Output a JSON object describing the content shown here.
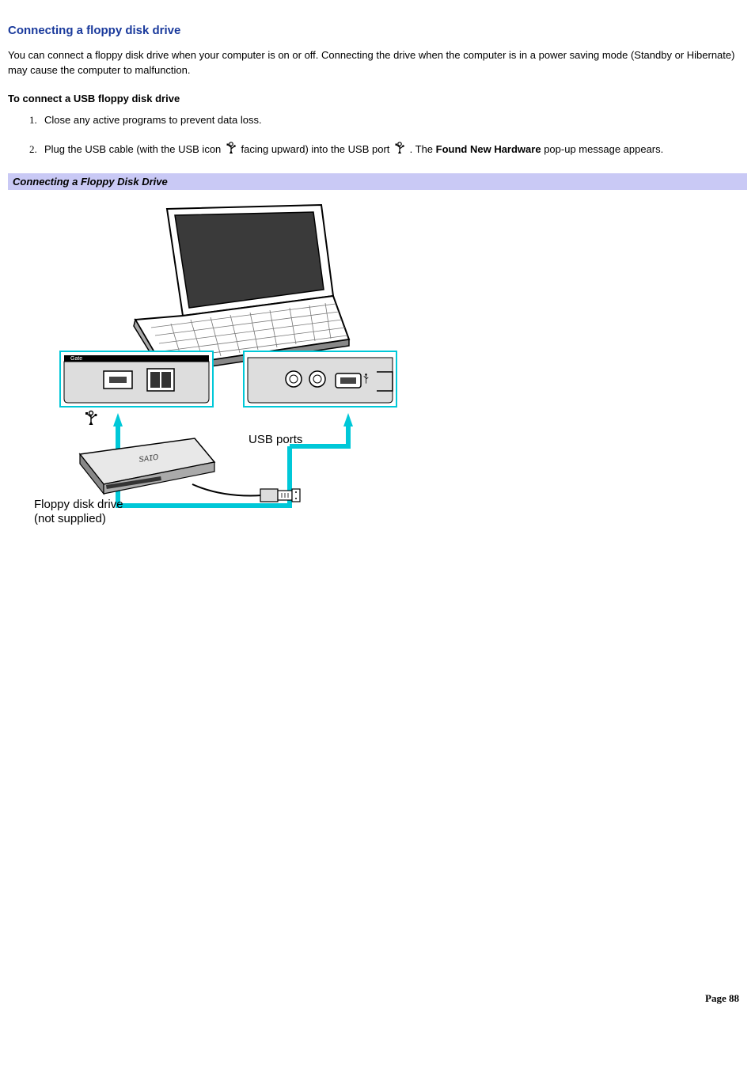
{
  "title": "Connecting a floppy disk drive",
  "intro": "You can connect a floppy disk drive when your computer is on or off. Connecting the drive when the computer is in a power saving mode (Standby or Hibernate) may cause the computer to malfunction.",
  "subheading": "To connect a USB floppy disk drive",
  "steps": {
    "1": "Close any active programs to prevent data loss.",
    "2_pre": "Plug the USB cable (with the USB icon ",
    "2_mid": " facing upward) into the USB port ",
    "2_after": ". The ",
    "2_bold": "Found New Hardware",
    "2_end": " pop-up message appears."
  },
  "figure": {
    "caption": "Connecting a Floppy Disk Drive",
    "labels": {
      "usb_ports": "USB ports",
      "floppy_line1": "Floppy disk drive",
      "floppy_line2": "(not supplied)"
    }
  },
  "page_label": "Page 88"
}
